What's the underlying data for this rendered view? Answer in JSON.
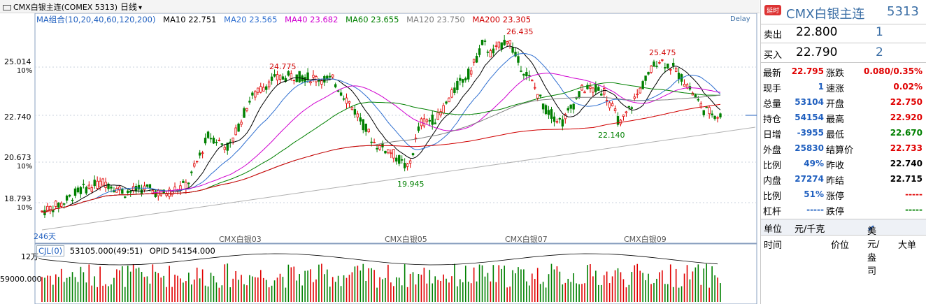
{
  "header": {
    "instrument": "CMX白银主连(COMEX 5313)",
    "period": "日线",
    "period_chevron": "chevron-down-icon"
  },
  "ma_legend": [
    {
      "label": "MA组合(10,20,40,60,120,200)",
      "color": "#1f5fbf"
    },
    {
      "label": "MA10 22.751",
      "color": "#000000"
    },
    {
      "label": "MA20 23.565",
      "color": "#2f6fd0"
    },
    {
      "label": "MA40 23.682",
      "color": "#d000d0"
    },
    {
      "label": "MA60 23.655",
      "color": "#008000"
    },
    {
      "label": "MA120 23.750",
      "color": "#808080"
    },
    {
      "label": "MA200 23.305",
      "color": "#d00000"
    }
  ],
  "delay_label": "Delay",
  "price_axis": [
    {
      "value": "25.014",
      "pct": "10%"
    },
    {
      "value": "22.740",
      "pct": ""
    },
    {
      "value": "20.673",
      "pct": "10%"
    },
    {
      "value": "18.793",
      "pct": "10%"
    }
  ],
  "month_labels": [
    "CMX白银03",
    "CMX白银05",
    "CMX白银07",
    "CMX白银09"
  ],
  "days_label": "246天",
  "annotations": [
    {
      "text": "24.775",
      "color": "#d00000"
    },
    {
      "text": "26.435",
      "color": "#d00000"
    },
    {
      "text": "25.475",
      "color": "#d00000"
    },
    {
      "text": "19.945",
      "color": "#008000"
    },
    {
      "text": "22.140",
      "color": "#008000"
    }
  ],
  "volume": {
    "title": "CJL(0)",
    "info": "53105.000(49:51)",
    "opid": "OPID 54154.000",
    "axis_top": "12万",
    "axis_mid": "59000.000"
  },
  "panel": {
    "badge": "延时",
    "name": "CMX白银主连",
    "code": "5313",
    "sell_label": "卖出",
    "sell_price": "22.800",
    "sell_vol": "1",
    "buy_label": "买入",
    "buy_price": "22.790",
    "buy_vol": "2",
    "quotes": [
      {
        "l1": "最新",
        "v1": "22.795",
        "c1": "red",
        "l2": "涨跌",
        "v2": "0.080/0.35%",
        "c2": "red"
      },
      {
        "l1": "现手",
        "v1": "1",
        "c1": "blue",
        "l2": "速涨",
        "v2": "0.02%",
        "c2": "red"
      },
      {
        "l1": "总量",
        "v1": "53104",
        "c1": "blue",
        "l2": "开盘",
        "v2": "22.750",
        "c2": "red"
      },
      {
        "l1": "持仓",
        "v1": "54154",
        "c1": "blue",
        "l2": "最高",
        "v2": "22.920",
        "c2": "red"
      },
      {
        "l1": "日增",
        "v1": "-3955",
        "c1": "blue",
        "l2": "最低",
        "v2": "22.670",
        "c2": "green"
      },
      {
        "l1": "外盘",
        "v1": "25830",
        "c1": "blue",
        "l2": "结算价",
        "v2": "22.733",
        "c2": "red"
      },
      {
        "l1": "比例",
        "v1": "49%",
        "c1": "blue",
        "l2": "昨收",
        "v2": "22.740",
        "c2": "black"
      },
      {
        "l1": "内盘",
        "v1": "27274",
        "c1": "blue",
        "l2": "昨结",
        "v2": "22.715",
        "c2": "black"
      },
      {
        "l1": "比例",
        "v1": "51%",
        "c1": "blue",
        "l2": "涨停",
        "v2": "-----",
        "c2": "red"
      },
      {
        "l1": "杠杆",
        "v1": "-----",
        "c1": "blue",
        "l2": "跌停",
        "v2": "-----",
        "c2": "green"
      }
    ],
    "unit_label": "单位",
    "unit_value": "元/千克",
    "unit_alt": "美元/盎司",
    "unit_check": "check-icon",
    "tick_headers": [
      "时间",
      "价位",
      "大单"
    ]
  },
  "colors": {
    "up": "#e00000",
    "down": "#008000"
  }
}
